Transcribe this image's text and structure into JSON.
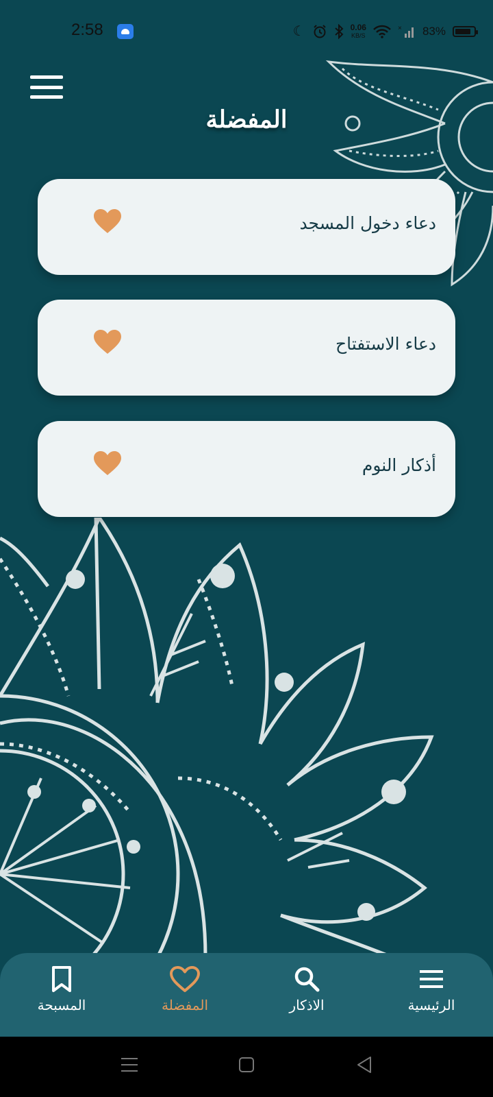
{
  "status_bar": {
    "time": "2:58",
    "icons": [
      "android-notification-icon",
      "moon-icon",
      "alarm-icon",
      "bluetooth-icon",
      "wifi-icon",
      "signal-icon",
      "battery-icon"
    ],
    "net_speed_value": "0.06",
    "net_speed_unit": "KB/S",
    "battery_percent": "83%"
  },
  "header": {
    "title": "المفضلة",
    "menu_icon": "hamburger-icon"
  },
  "favorites": [
    {
      "title": "دعاء دخول المسجد",
      "icon": "heart-icon"
    },
    {
      "title": "دعاء الاستفتاح",
      "icon": "heart-icon"
    },
    {
      "title": "أذكار النوم",
      "icon": "heart-icon"
    }
  ],
  "bottom_nav": {
    "items": [
      {
        "label": "المسبحة",
        "icon": "bookmark-icon",
        "active": false
      },
      {
        "label": "المفضلة",
        "icon": "heart-outline-icon",
        "active": true
      },
      {
        "label": "الاذكار",
        "icon": "search-icon",
        "active": false
      },
      {
        "label": "الرئيسية",
        "icon": "menu-icon",
        "active": false
      }
    ]
  },
  "colors": {
    "background": "#0b4752",
    "card": "#eef3f4",
    "accent": "#e3995a",
    "nav_bar": "#216370",
    "text_dark": "#163b46"
  },
  "system_nav": [
    "recent-apps-icon",
    "home-icon",
    "back-icon"
  ]
}
